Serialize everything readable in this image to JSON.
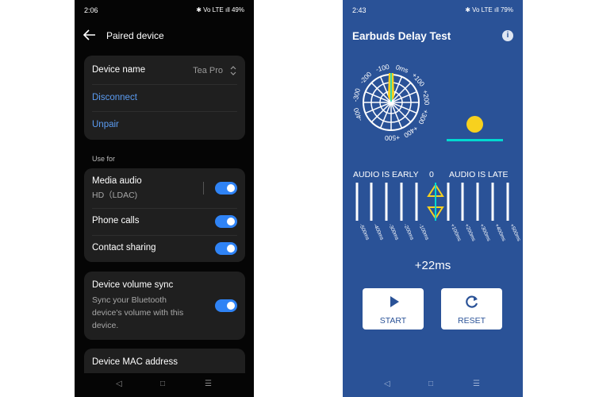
{
  "left": {
    "status": {
      "time": "2:06",
      "icons": "✱ Vo LTE ıll 49%"
    },
    "title": "Paired device",
    "device_name_label": "Device name",
    "device_name_value": "Tea Pro",
    "disconnect": "Disconnect",
    "unpair": "Unpair",
    "use_for": "Use for",
    "media_audio": "Media audio",
    "media_audio_sub": "HD（LDAC)",
    "phone_calls": "Phone calls",
    "contact_sharing": "Contact sharing",
    "volume_sync_title": "Device volume sync",
    "volume_sync_desc": "Sync your Bluetooth device's volume with this device.",
    "mac_address": "Device MAC address",
    "toggles": {
      "media_audio": true,
      "phone_calls": true,
      "contact_sharing": true,
      "volume_sync": true
    },
    "nav": {
      "back": "◁",
      "home": "□",
      "recents": "☰"
    }
  },
  "right": {
    "status": {
      "time": "2:43",
      "icons": "✱ Vo LTE ıll 79%"
    },
    "title": "Earbuds Delay Test",
    "info": "i",
    "dial_labels": [
      "-400",
      "-300",
      "-200",
      "-100",
      "0ms",
      "+100",
      "+200",
      "+300",
      "+400",
      "+500"
    ],
    "early": "AUDIO IS EARLY",
    "zero": "0",
    "late": "AUDIO IS LATE",
    "scale_labels": [
      "-500ms",
      "-400ms",
      "-300ms",
      "-200ms",
      "-100ms",
      "+100ms",
      "+200ms",
      "+300ms",
      "+400ms",
      "+500ms"
    ],
    "delay": "+22ms",
    "start": "START",
    "reset": "RESET",
    "nav": {
      "back": "◁",
      "home": "□",
      "recents": "☰"
    }
  },
  "colors": {
    "toggle_on": "#2f83f5",
    "link": "#5b9cf2",
    "app_bg": "#2a5297",
    "ball": "#f7d11e",
    "cyan_line": "#00d9d0"
  }
}
